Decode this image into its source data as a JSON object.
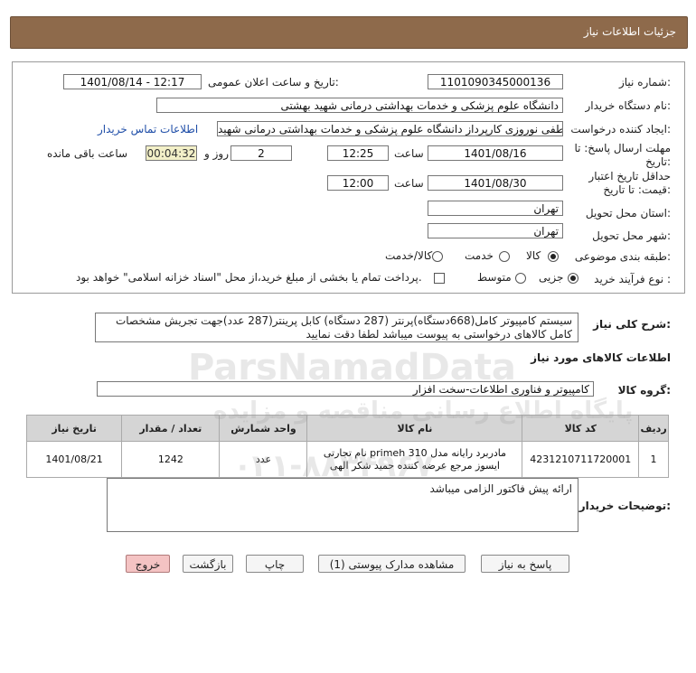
{
  "header": {
    "title": "جزئیات اطلاعات نیاز"
  },
  "fields": {
    "need_number_label": "شماره نیاز:",
    "need_number": "1101090345000136",
    "announce_label": "تاریخ و ساعت اعلان عمومی:",
    "announce_value": "1401/08/14 - 12:17",
    "buyer_label": "نام دستگاه خریدار:",
    "buyer_value": "دانشگاه علوم پزشکی و خدمات بهداشتی درمانی شهید بهشتی",
    "creator_label": "ایجاد کننده درخواست:",
    "creator_value": "مصطفی نوروزی کارپرداز دانشگاه علوم پزشکی و خدمات بهداشتی درمانی شهید",
    "contact_link": "اطلاعات تماس خریدار",
    "deadline_label_1": "مهلت ارسال پاسخ: تا",
    "deadline_label_2": "تاریخ:",
    "deadline_date": "1401/08/16",
    "time_label": "ساعت",
    "deadline_time": "12:25",
    "days_value": "2",
    "days_label": "روز و",
    "remaining_time": "00:04:32",
    "remaining_label": "ساعت باقی مانده",
    "validity_label_1": "حداقل تاریخ اعتبار",
    "validity_label_2": "قیمت: تا تاریخ:",
    "validity_date": "1401/08/30",
    "validity_time": "12:00",
    "province_label": "استان محل تحویل:",
    "province_value": "تهران",
    "city_label": "شهر محل تحویل:",
    "city_value": "تهران",
    "category_label": "طبقه بندی موضوعی:",
    "category_options": [
      "کالا",
      "خدمت",
      "کالا/خدمت"
    ],
    "category_selected": "کالا",
    "process_label": "نوع فرآیند خرید :",
    "process_options": [
      "جزیی",
      "متوسط"
    ],
    "process_selected": "جزیی",
    "payment_note": "پرداخت تمام یا بخشی از مبلغ خرید،از محل \"اسناد خزانه اسلامی\" خواهد بود."
  },
  "description": {
    "label": "شرح کلی نیاز:",
    "text": "سیستم کامپیوتر کامل(668دستگاه)پرنتر (287 دستگاه) کابل پرینتر(287 عدد)جهت تجریش مشخصات کامل کالاهای درخواستی به پیوست میباشد لطفا دقت نمایید"
  },
  "goods": {
    "section_title": "اطلاعات کالاهای مورد نیاز",
    "group_label": "گروه کالا:",
    "group_value": "کامپیوتر و فناوری اطلاعات-سخت افزار",
    "columns": [
      "ردیف",
      "کد کالا",
      "نام کالا",
      "واحد شمارش",
      "تعداد / مقدار",
      "تاریخ نیاز"
    ],
    "rows": [
      {
        "row": "1",
        "code": "4231210711720001",
        "name": "مادربرد رایانه مدل primeh 310 نام تجارتی ایسوز مرجع عرضه کننده حمید شکر الهی",
        "unit": "عدد",
        "qty": "1242",
        "date": "1401/08/21"
      }
    ]
  },
  "buyer_notes": {
    "label": "توضیحات خریدار:",
    "text": "ارائه پیش فاکتور الزامی میباشد"
  },
  "buttons": {
    "reply": "پاسخ به نیاز",
    "attachments": "مشاهده مدارک پیوستی (1)",
    "print": "چاپ",
    "back": "بازگشت",
    "exit": "خروج"
  },
  "watermark": {
    "brand": "ParsNamadData",
    "persian": "پایگاه اطلاع رسانی مناقصه و مزایده",
    "phone": "۰۲۱-۸۸۳۴۹۶۷۰"
  },
  "colors": {
    "header": "#8e6a4b",
    "yellow_box": "#f3f0c8",
    "table_header": "#d5d5d5",
    "exit_button": "#f4c3c3"
  }
}
